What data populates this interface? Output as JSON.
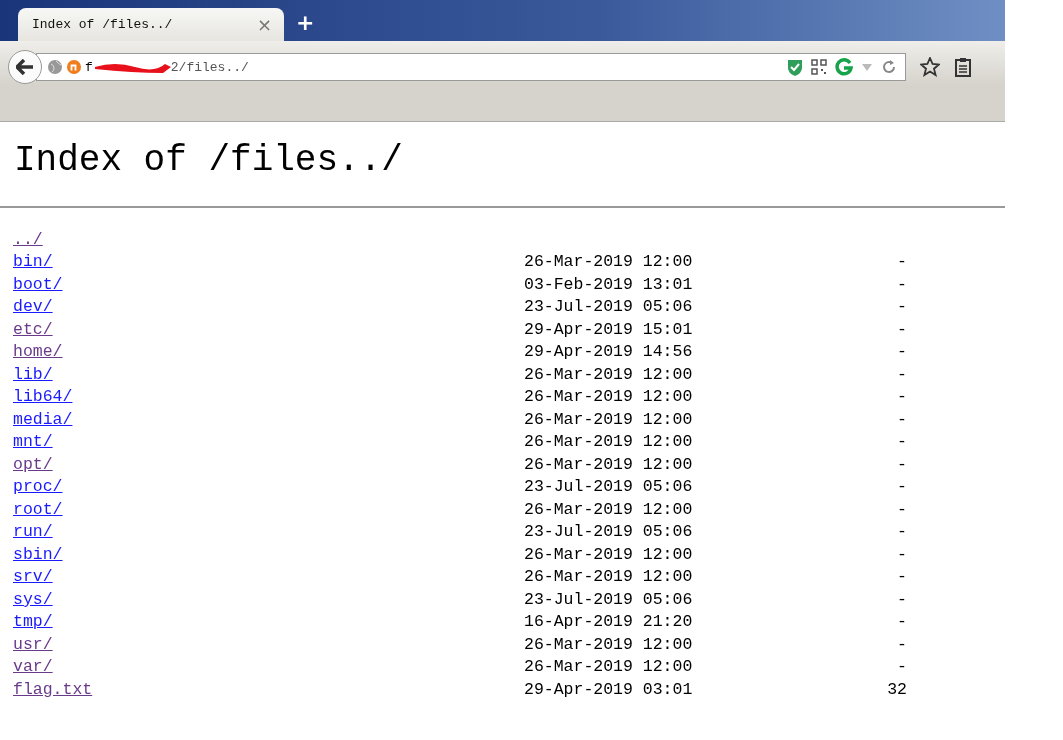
{
  "tab": {
    "title": "Index of /files../",
    "close": "×",
    "new_tab": "+"
  },
  "address_bar": {
    "url_start": "f",
    "url_end": "2/files../"
  },
  "page": {
    "heading": "Index of /files../",
    "entries": [
      {
        "name": "../",
        "visited": true
      },
      {
        "name": "bin/",
        "date": "26-Mar-2019 12:00",
        "size": "-",
        "visited": false
      },
      {
        "name": "boot/",
        "date": "03-Feb-2019 13:01",
        "size": "-",
        "visited": false
      },
      {
        "name": "dev/",
        "date": "23-Jul-2019 05:06",
        "size": "-",
        "visited": false
      },
      {
        "name": "etc/",
        "date": "29-Apr-2019 15:01",
        "size": "-",
        "visited": true
      },
      {
        "name": "home/",
        "date": "29-Apr-2019 14:56",
        "size": "-",
        "visited": true
      },
      {
        "name": "lib/",
        "date": "26-Mar-2019 12:00",
        "size": "-",
        "visited": false
      },
      {
        "name": "lib64/",
        "date": "26-Mar-2019 12:00",
        "size": "-",
        "visited": false
      },
      {
        "name": "media/",
        "date": "26-Mar-2019 12:00",
        "size": "-",
        "visited": false
      },
      {
        "name": "mnt/",
        "date": "26-Mar-2019 12:00",
        "size": "-",
        "visited": false
      },
      {
        "name": "opt/",
        "date": "26-Mar-2019 12:00",
        "size": "-",
        "visited": true
      },
      {
        "name": "proc/",
        "date": "23-Jul-2019 05:06",
        "size": "-",
        "visited": false
      },
      {
        "name": "root/",
        "date": "26-Mar-2019 12:00",
        "size": "-",
        "visited": false
      },
      {
        "name": "run/",
        "date": "23-Jul-2019 05:06",
        "size": "-",
        "visited": false
      },
      {
        "name": "sbin/",
        "date": "26-Mar-2019 12:00",
        "size": "-",
        "visited": false
      },
      {
        "name": "srv/",
        "date": "26-Mar-2019 12:00",
        "size": "-",
        "visited": false
      },
      {
        "name": "sys/",
        "date": "23-Jul-2019 05:06",
        "size": "-",
        "visited": false
      },
      {
        "name": "tmp/",
        "date": "16-Apr-2019 21:20",
        "size": "-",
        "visited": false
      },
      {
        "name": "usr/",
        "date": "26-Mar-2019 12:00",
        "size": "-",
        "visited": true
      },
      {
        "name": "var/",
        "date": "26-Mar-2019 12:00",
        "size": "-",
        "visited": true
      },
      {
        "name": "flag.txt",
        "date": "29-Apr-2019 03:01",
        "size": "32",
        "visited": true
      }
    ]
  }
}
